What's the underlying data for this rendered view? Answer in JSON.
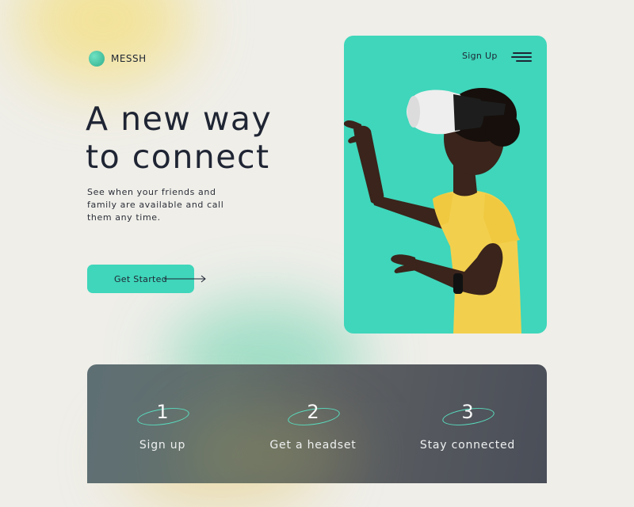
{
  "brand": {
    "name": "MESSH"
  },
  "hero": {
    "title_line1": "A new way",
    "title_line2": "to connect",
    "subtitle_line1": "See when your friends and",
    "subtitle_line2": "family are available and call",
    "subtitle_line3": "them any time.",
    "cta_label": "Get Started"
  },
  "nav": {
    "signup_label": "Sign Up"
  },
  "steps": [
    {
      "number": "1",
      "label": "Sign up"
    },
    {
      "number": "2",
      "label": "Get a headset"
    },
    {
      "number": "3",
      "label": "Stay connected"
    }
  ],
  "colors": {
    "accent": "#3fd6bb",
    "text": "#1f2533",
    "background": "#efeee9",
    "panel": "#555d63",
    "shirt": "#f2d04e"
  }
}
